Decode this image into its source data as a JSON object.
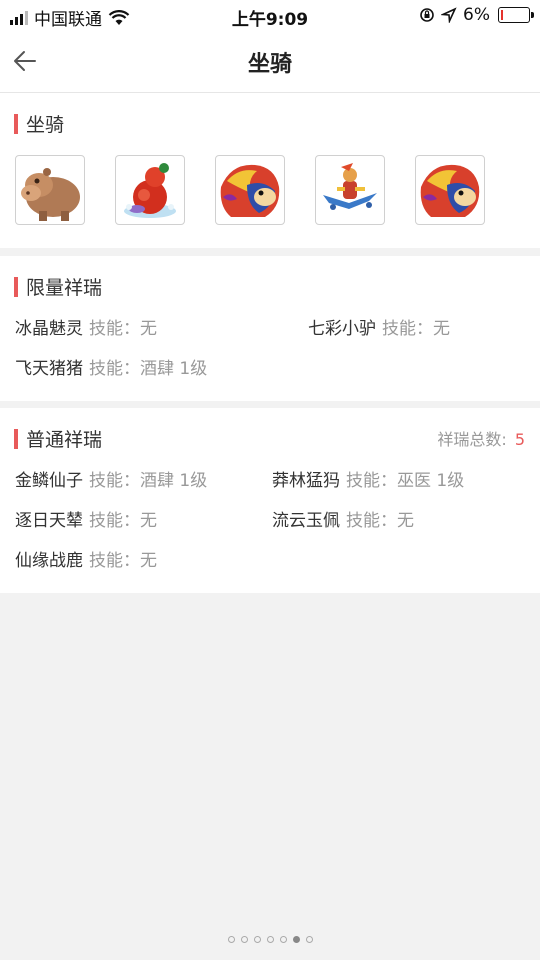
{
  "status_bar": {
    "carrier": "中国联通",
    "time": "上午9:09",
    "battery": "6%",
    "battery_level": 0.06
  },
  "header": {
    "title": "坐骑"
  },
  "mounts_section": {
    "title": "坐骑",
    "mounts": [
      {
        "icon": "brown-hippo-mount-icon"
      },
      {
        "icon": "red-gourd-mount-icon"
      },
      {
        "icon": "fire-lion-mount-icon"
      },
      {
        "icon": "flying-monkey-mount-icon"
      },
      {
        "icon": "fire-lion-mount-icon"
      }
    ]
  },
  "limited_section": {
    "title": "限量祥瑞",
    "items": [
      {
        "name": "冰晶魅灵",
        "skill_label": "技能：",
        "skill": "无"
      },
      {
        "name": "七彩小驴",
        "skill_label": "技能：",
        "skill": "无"
      },
      {
        "name": "飞天猪猪",
        "skill_label": "技能：",
        "skill": "酒肆 1级"
      }
    ]
  },
  "normal_section": {
    "title": "普通祥瑞",
    "total_label": "祥瑞总数:",
    "total": "5",
    "items": [
      {
        "name": "金鳞仙子",
        "skill_label": "技能：",
        "skill": "酒肆 1级"
      },
      {
        "name": "莽林猛犸",
        "skill_label": "技能：",
        "skill": "巫医 1级"
      },
      {
        "name": "逐日天辇",
        "skill_label": "技能：",
        "skill": "无"
      },
      {
        "name": "流云玉佩",
        "skill_label": "技能：",
        "skill": "无"
      },
      {
        "name": "仙缘战鹿",
        "skill_label": "技能：",
        "skill": "无"
      }
    ]
  },
  "pager": {
    "count": 7,
    "active_index": 5
  },
  "colors": {
    "accent": "#e85a5a",
    "muted": "#999999"
  }
}
